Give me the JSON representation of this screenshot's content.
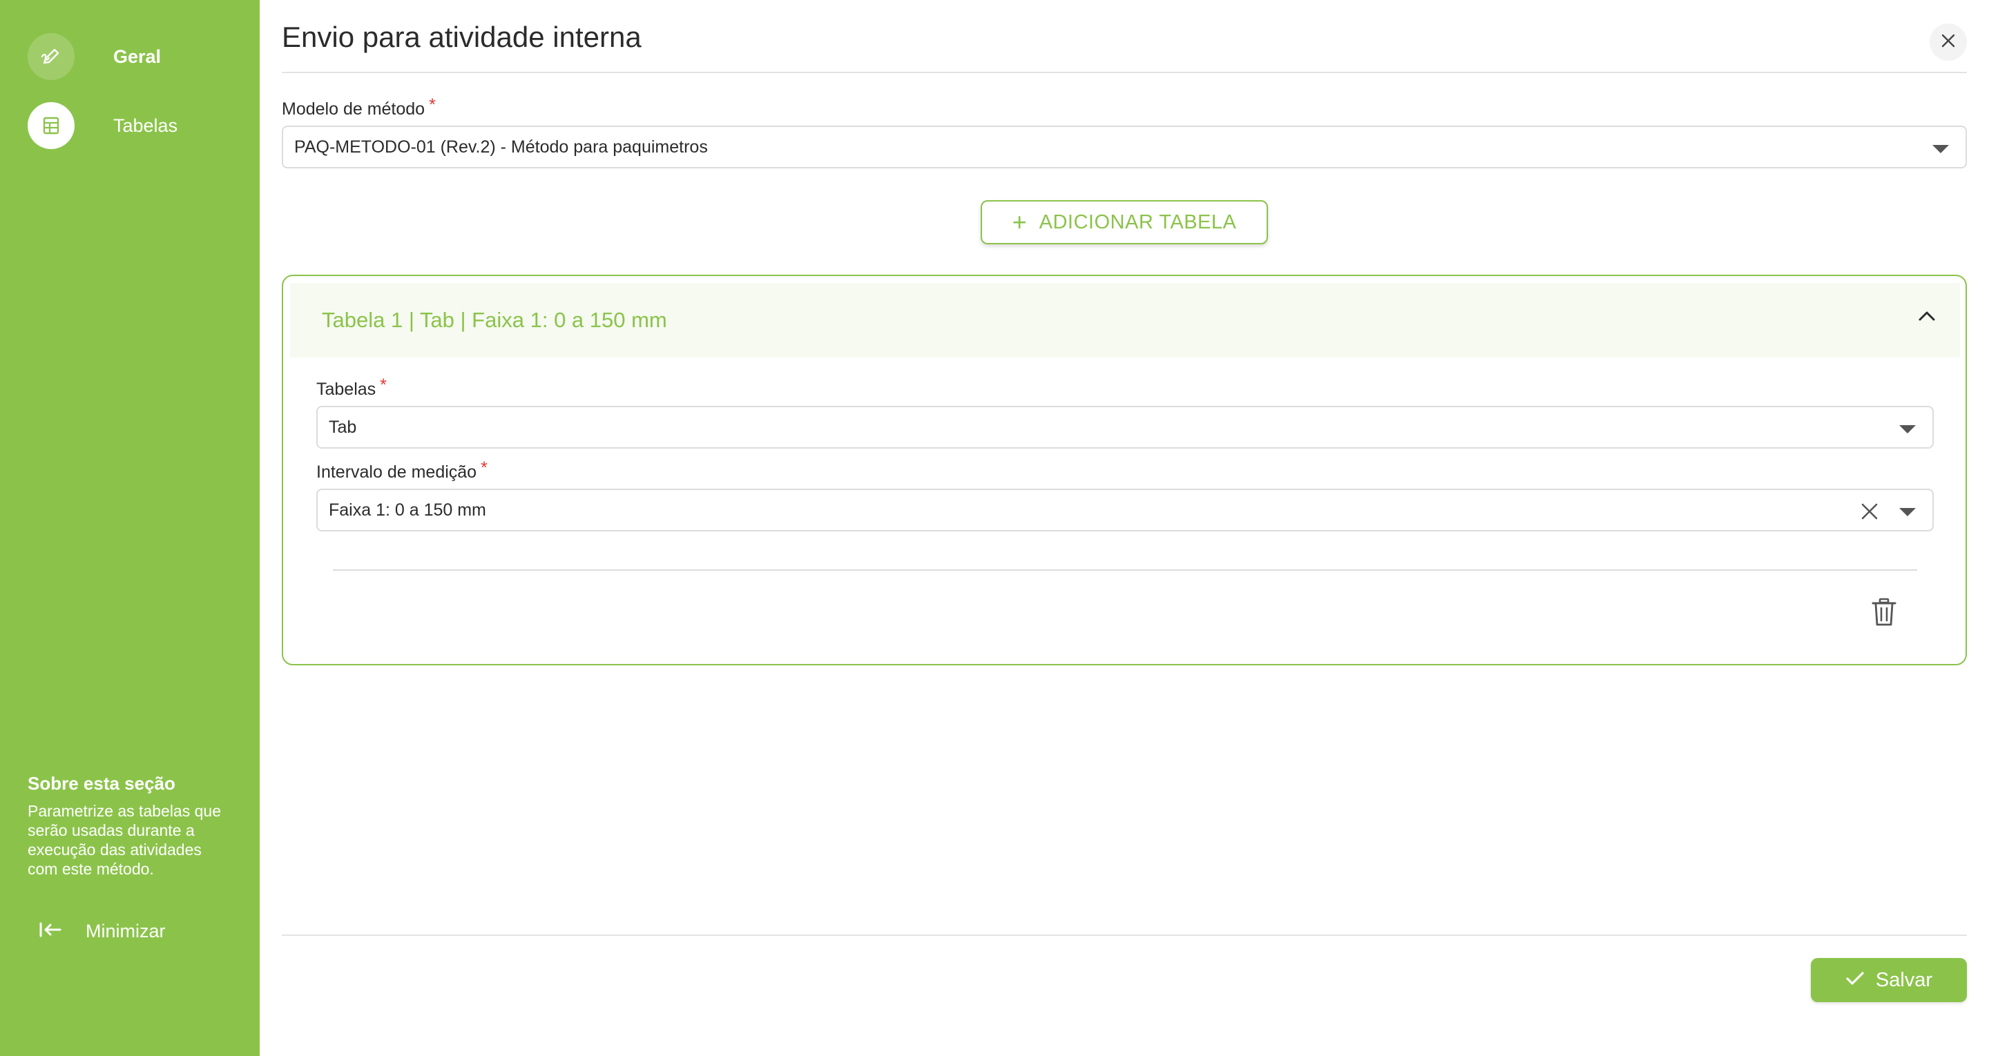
{
  "sidebar": {
    "items": [
      {
        "label": "Geral",
        "icon": "pencil-icon",
        "active": false
      },
      {
        "label": "Tabelas",
        "icon": "table-icon",
        "active": true
      }
    ],
    "about": {
      "title": "Sobre esta seção",
      "text": "Parametrize as tabelas que serão usadas durante a execução das atividades com este método."
    },
    "minimize_label": "Minimizar",
    "minimize_icon": "collapse-left-icon"
  },
  "header": {
    "title": "Envio para atividade interna",
    "close_icon": "close-icon"
  },
  "form": {
    "method_label": "Modelo de método",
    "required_mark": "*",
    "method_value": "PAQ-METODO-01 (Rev.2) - Método para paquimetros",
    "add_table_label": "ADICIONAR TABELA",
    "add_table_icon": "plus-icon"
  },
  "table_card": {
    "title": "Tabela 1 | Tab | Faixa 1: 0 a 150 mm",
    "expanded": true,
    "tables_label": "Tabelas",
    "tables_value": "Tab",
    "interval_label": "Intervalo de medição",
    "interval_value": "Faixa 1: 0 a 150 mm",
    "delete_icon": "trash-icon"
  },
  "footer": {
    "save_label": "Salvar",
    "save_icon": "check-icon"
  },
  "colors": {
    "accent": "#8bc34a",
    "required": "#e53935",
    "card_header_bg": "#f6faf1"
  }
}
